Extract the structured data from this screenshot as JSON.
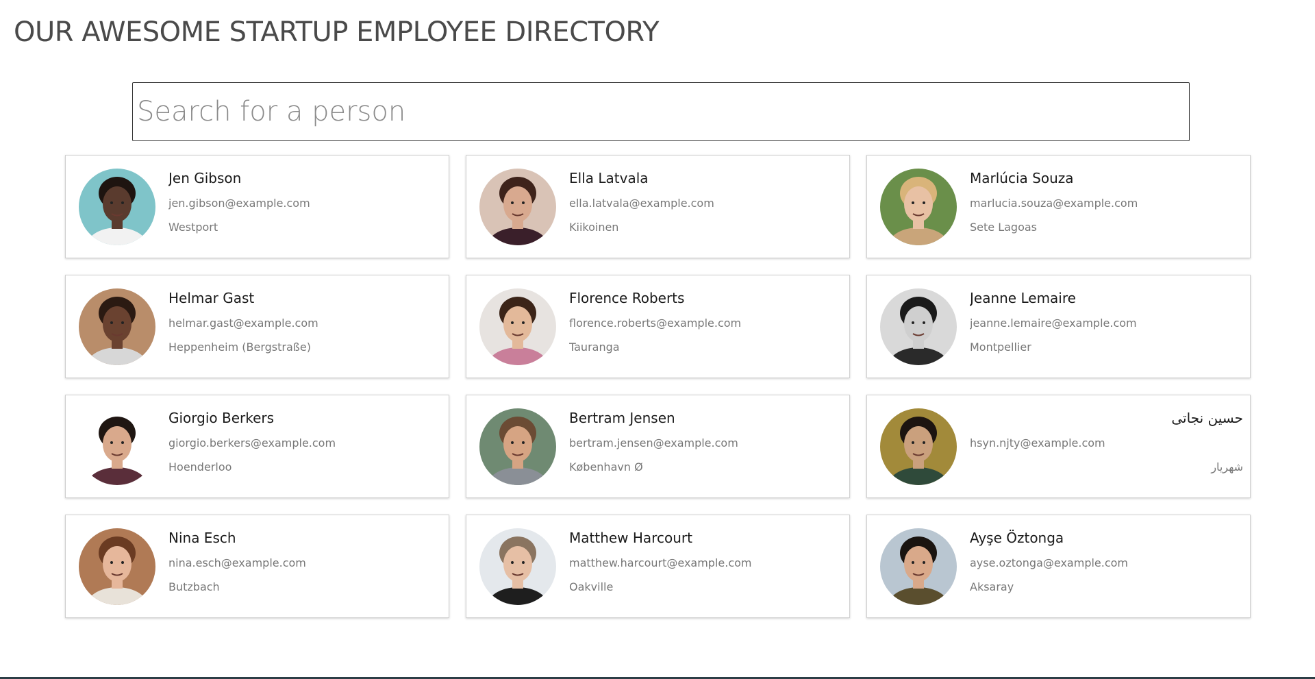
{
  "page": {
    "title": "OUR AWESOME STARTUP EMPLOYEE DIRECTORY"
  },
  "search": {
    "placeholder": "Search for a person",
    "value": ""
  },
  "employees": [
    {
      "name": "Jen Gibson",
      "email": "jen.gibson@example.com",
      "city": "Westport",
      "photo": {
        "bg": "#7fc4c9",
        "skin": "#5a3b2e",
        "hair": "#1e1410",
        "shirt": "#f2f2f2"
      }
    },
    {
      "name": "Ella Latvala",
      "email": "ella.latvala@example.com",
      "city": "Kiikoinen",
      "photo": {
        "bg": "#d9c3b6",
        "skin": "#d8a98f",
        "hair": "#3e231b",
        "shirt": "#3a1f2a"
      }
    },
    {
      "name": "Marlúcia Souza",
      "email": "marlucia.souza@example.com",
      "city": "Sete Lagoas",
      "photo": {
        "bg": "#6a8f4a",
        "skin": "#e8c1a4",
        "hair": "#d9b47a",
        "shirt": "#c9a57a"
      }
    },
    {
      "name": "Helmar Gast",
      "email": "helmar.gast@example.com",
      "city": "Heppenheim (Bergstraße)",
      "photo": {
        "bg": "#b98d6a",
        "skin": "#6a4230",
        "hair": "#2b1a12",
        "shirt": "#d7d7d7"
      }
    },
    {
      "name": "Florence Roberts",
      "email": "florence.roberts@example.com",
      "city": "Tauranga",
      "photo": {
        "bg": "#e7e3e0",
        "skin": "#e3b99a",
        "hair": "#3b2418",
        "shirt": "#c97f9a"
      }
    },
    {
      "name": "Jeanne Lemaire",
      "email": "jeanne.lemaire@example.com",
      "city": "Montpellier",
      "photo": {
        "bg": "#d9d9d9",
        "skin": "#cfcfcf",
        "hair": "#1a1a1a",
        "shirt": "#2a2a2a"
      }
    },
    {
      "name": "Giorgio Berkers",
      "email": "giorgio.berkers@example.com",
      "city": "Hoenderloo",
      "photo": {
        "bg": "#ffffff",
        "skin": "#d9a98c",
        "hair": "#1f1612",
        "shirt": "#5a2e3a"
      }
    },
    {
      "name": "Bertram Jensen",
      "email": "bertram.jensen@example.com",
      "city": "København Ø",
      "photo": {
        "bg": "#6f8a72",
        "skin": "#d6a483",
        "hair": "#6b4b34",
        "shirt": "#8a8f96"
      }
    },
    {
      "name": "حسين نجاتی",
      "email": "hsyn.njty@example.com",
      "city": "شهریار",
      "photo": {
        "bg": "#a28a3a",
        "skin": "#caa07d",
        "hair": "#1c1410",
        "shirt": "#2f4a3a"
      }
    },
    {
      "name": "Nina Esch",
      "email": "nina.esch@example.com",
      "city": "Butzbach",
      "photo": {
        "bg": "#b07a55",
        "skin": "#e6b79b",
        "hair": "#6a3b22",
        "shirt": "#e8e2d9"
      }
    },
    {
      "name": "Matthew Harcourt",
      "email": "matthew.harcourt@example.com",
      "city": "Oakville",
      "photo": {
        "bg": "#e4e8ec",
        "skin": "#e6bfa5",
        "hair": "#8a7460",
        "shirt": "#1e1e1e"
      }
    },
    {
      "name": "Ayşe Öztonga",
      "email": "ayse.oztonga@example.com",
      "city": "Aksaray",
      "photo": {
        "bg": "#b9c6d1",
        "skin": "#d9a98a",
        "hair": "#1a1410",
        "shirt": "#5a4e2e"
      }
    }
  ]
}
